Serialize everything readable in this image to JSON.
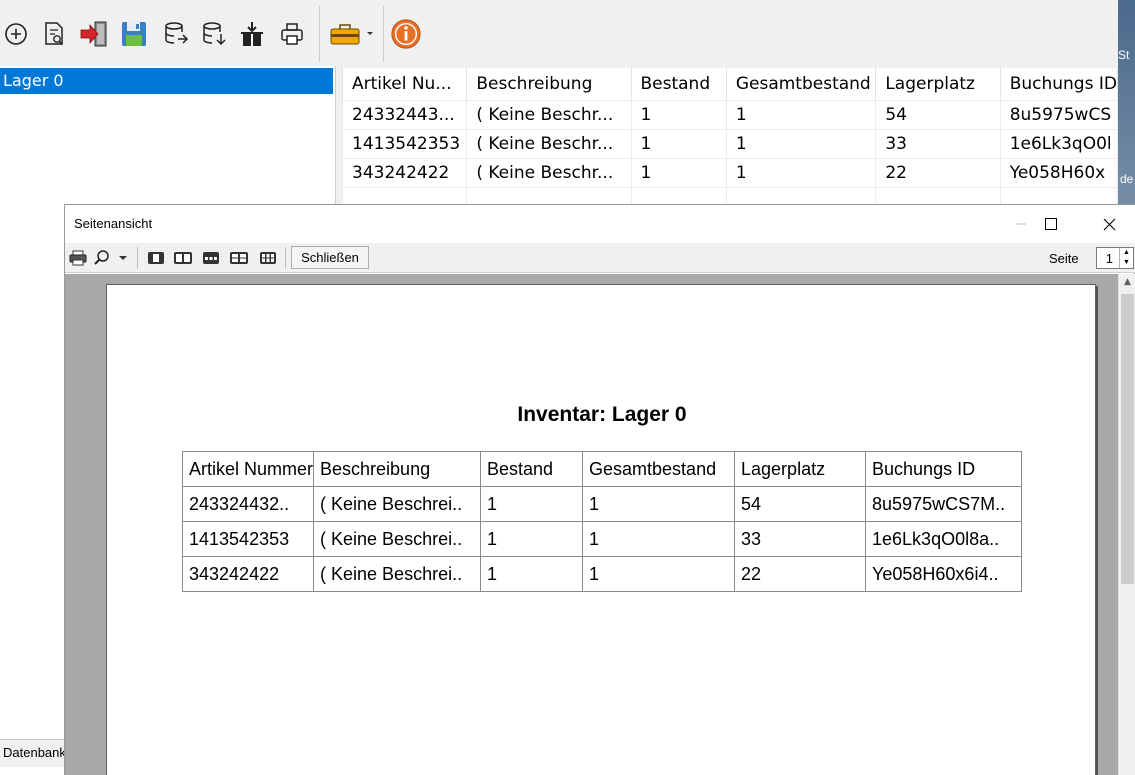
{
  "toolbar": {
    "icons": [
      "add-icon",
      "search-document-icon",
      "import-icon",
      "save-icon",
      "database-export-icon",
      "database-import-icon",
      "stock-in-icon",
      "print-icon",
      "toolbox-icon",
      "info-icon"
    ]
  },
  "tree": {
    "items": [
      {
        "label": "Lager 0"
      }
    ]
  },
  "status": {
    "tab_label": "Datenbank"
  },
  "desktop": {
    "text1": "St",
    "text2": "de"
  },
  "grid": {
    "columns": [
      "Artikel Nu...",
      "Beschreibung",
      "Bestand",
      "Gesamtbestand",
      "Lagerplatz",
      "Buchungs ID"
    ],
    "rows": [
      [
        "24332443...",
        "( Keine Beschr...",
        "1",
        "1",
        "54",
        "8u5975wCS"
      ],
      [
        "1413542353",
        "( Keine Beschr...",
        "1",
        "1",
        "33",
        "1e6Lk3qO0l"
      ],
      [
        "343242422",
        "( Keine Beschr...",
        "1",
        "1",
        "22",
        "Ye058H60x"
      ]
    ]
  },
  "preview": {
    "window_title": "Seitenansicht",
    "close_label": "Schließen",
    "page_label": "Seite",
    "page_value": "1",
    "report_title": "Inventar: Lager 0",
    "columns": [
      "Artikel Nummer",
      "Beschreibung",
      "Bestand",
      "Gesamtbestand",
      "Lagerplatz",
      "Buchungs ID"
    ],
    "rows": [
      [
        "243324432..",
        "( Keine Beschrei..",
        "1",
        "1",
        "54",
        "8u5975wCS7M.."
      ],
      [
        "1413542353",
        "( Keine Beschrei..",
        "1",
        "1",
        "33",
        "1e6Lk3qO0l8a.."
      ],
      [
        "343242422",
        "( Keine Beschrei..",
        "1",
        "1",
        "22",
        "Ye058H60x6i4.."
      ]
    ]
  },
  "colors": {
    "selection": "#0078d7",
    "info_orange": "#e8712a",
    "canvas_gray": "#a8a8a8"
  }
}
